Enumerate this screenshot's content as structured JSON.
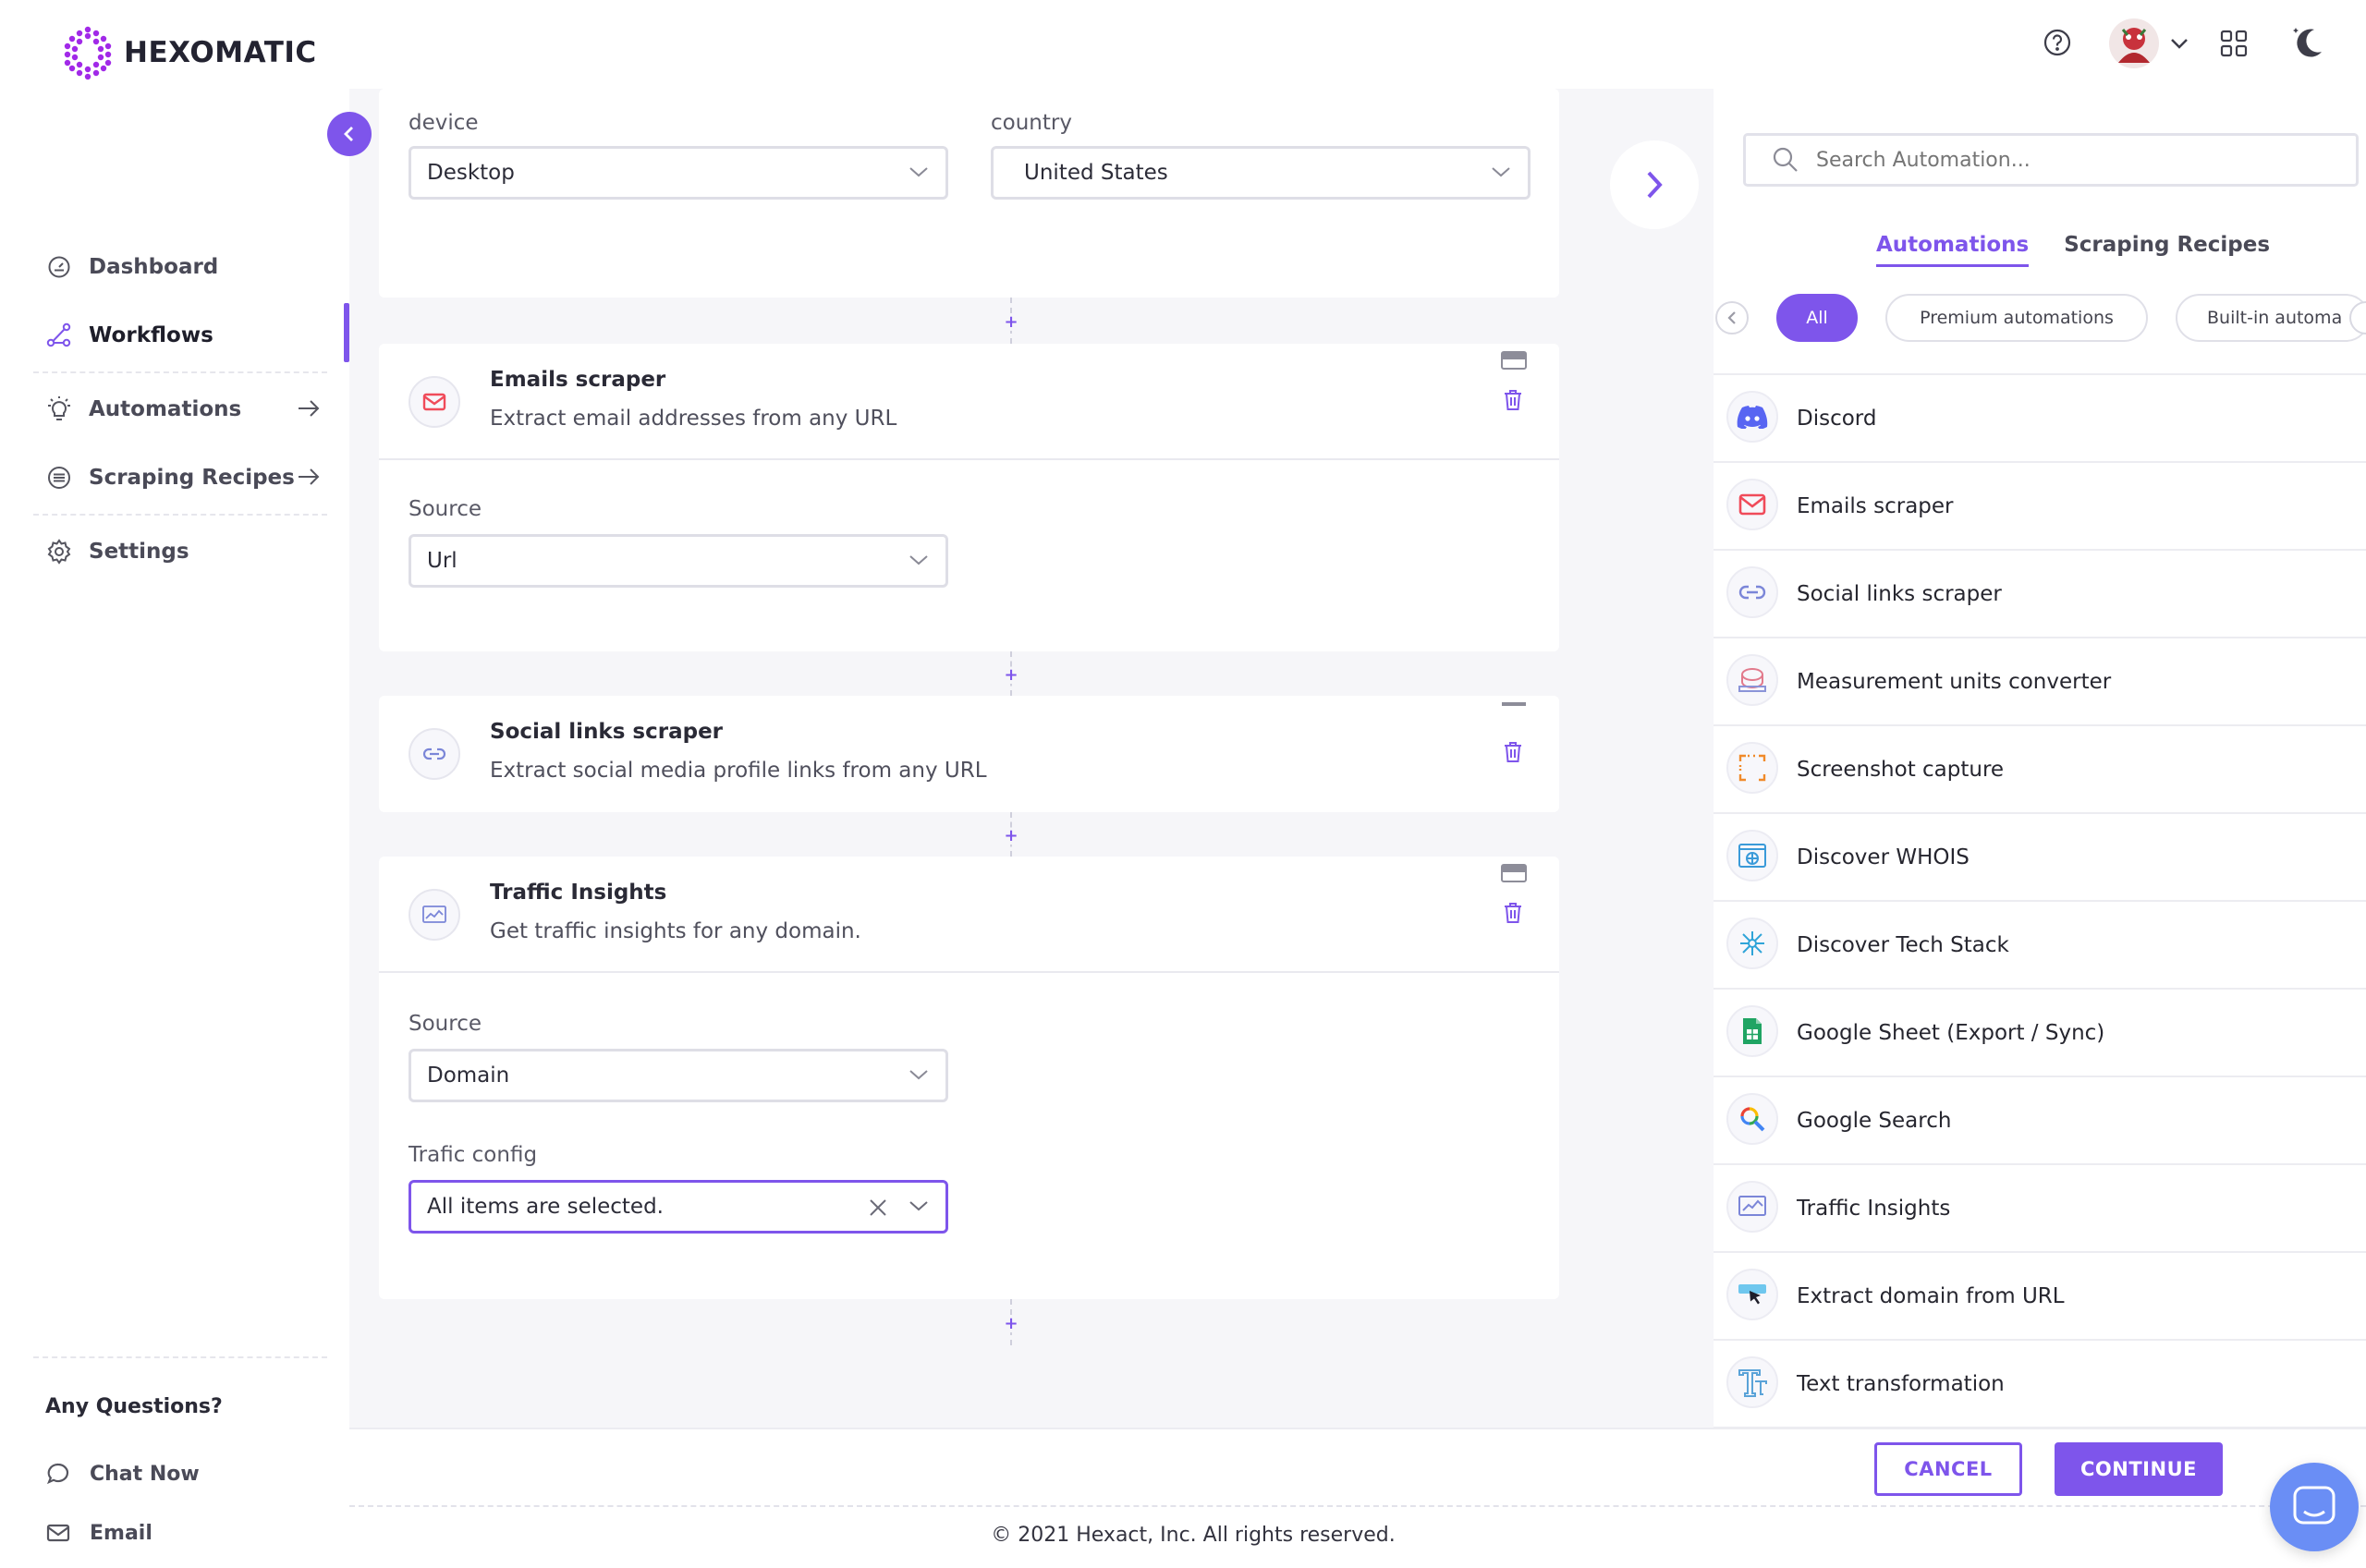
{
  "brand": {
    "name": "HEXOMATIC"
  },
  "sidebar": {
    "nav": [
      {
        "label": "Dashboard",
        "icon": "dashboard-icon"
      },
      {
        "label": "Workflows",
        "icon": "workflows-icon",
        "active": true
      },
      {
        "label": "Automations",
        "icon": "lightbulb-icon"
      },
      {
        "label": "Scraping Recipes",
        "icon": "recipes-icon"
      },
      {
        "label": "Settings",
        "icon": "gear-icon"
      }
    ],
    "questions": {
      "title": "Any Questions?",
      "chat": "Chat Now",
      "email": "Email"
    }
  },
  "workflow": {
    "top_card": {
      "device_label": "device",
      "device_value": "Desktop",
      "country_label": "country",
      "country_value": "United States"
    },
    "emails": {
      "title": "Emails scraper",
      "desc": "Extract email addresses from any URL",
      "source_label": "Source",
      "source_value": "Url"
    },
    "social": {
      "title": "Social links scraper",
      "desc": "Extract social media profile links from any URL"
    },
    "traffic": {
      "title": "Traffic Insights",
      "desc": "Get traffic insights for any domain.",
      "source_label": "Source",
      "source_value": "Domain",
      "config_label": "Trafic config",
      "config_value": "All items are selected."
    },
    "plus": "+"
  },
  "panel": {
    "search_placeholder": "Search Automation...",
    "tabs": [
      "Automations",
      "Scraping Recipes"
    ],
    "chips": [
      "All",
      "Premium automations",
      "Built-in automa"
    ],
    "items": [
      "Discord",
      "Emails scraper",
      "Social links scraper",
      "Measurement units converter",
      "Screenshot capture",
      "Discover WHOIS",
      "Discover Tech Stack",
      "Google Sheet (Export / Sync)",
      "Google Search",
      "Traffic Insights",
      "Extract domain from URL",
      "Text transformation"
    ]
  },
  "actions": {
    "cancel": "CANCEL",
    "continue": "CONTINUE"
  },
  "footer": {
    "copyright": "© 2021 Hexact, Inc. All rights reserved."
  },
  "colors": {
    "accent": "#7e55eb",
    "background": "#f6f6f9",
    "chat": "#6a8ef5"
  }
}
